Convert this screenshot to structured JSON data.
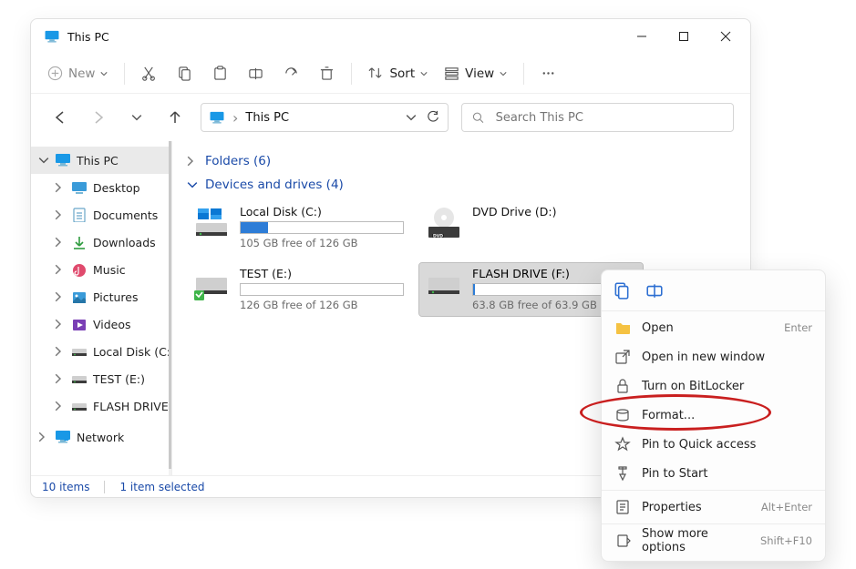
{
  "title": "This PC",
  "toolbar": {
    "new": "New",
    "sort": "Sort",
    "view": "View"
  },
  "address": {
    "segment": "This PC",
    "arrow": "›"
  },
  "search": {
    "placeholder": "Search This PC"
  },
  "nav": {
    "items": [
      {
        "label": "This PC",
        "kind": "thispc",
        "expanded": true,
        "selected": true
      },
      {
        "label": "Desktop",
        "kind": "desktop"
      },
      {
        "label": "Documents",
        "kind": "documents"
      },
      {
        "label": "Downloads",
        "kind": "downloads"
      },
      {
        "label": "Music",
        "kind": "music"
      },
      {
        "label": "Pictures",
        "kind": "pictures"
      },
      {
        "label": "Videos",
        "kind": "videos"
      },
      {
        "label": "Local Disk (C:)",
        "kind": "hdd"
      },
      {
        "label": "TEST (E:)",
        "kind": "usb"
      },
      {
        "label": "FLASH DRIVE (F:)",
        "kind": "usb",
        "clipped": "FLASH DRIVE (F"
      },
      {
        "label": "Network",
        "kind": "network",
        "section": true
      }
    ]
  },
  "groups": {
    "folders": {
      "label": "Folders (6)"
    },
    "drives": {
      "label": "Devices and drives (4)"
    }
  },
  "drives": [
    {
      "name": "Local Disk (C:)",
      "free": "105 GB free of 126 GB",
      "fill_pct": 17,
      "fill_color": "#2e7dd7",
      "icon": "win-hdd"
    },
    {
      "name": "DVD Drive (D:)",
      "icon": "dvd"
    },
    {
      "name": "TEST (E:)",
      "free": "126 GB free of 126 GB",
      "fill_pct": 0,
      "fill_color": "#2e7dd7",
      "icon": "hdd-link"
    },
    {
      "name": "FLASH DRIVE (F:)",
      "free": "63.8 GB free of 63.9 GB",
      "fill_pct": 1,
      "fill_color": "#2e7dd7",
      "icon": "hdd",
      "selected": true
    }
  ],
  "status": {
    "items": "10 items",
    "selected": "1 item selected"
  },
  "ctx": {
    "items": [
      {
        "label": "Open",
        "icon": "folder",
        "shortcut": "Enter"
      },
      {
        "label": "Open in new window",
        "icon": "popout"
      },
      {
        "label": "Turn on BitLocker",
        "icon": "lock"
      },
      {
        "label": "Format...",
        "icon": "format"
      },
      {
        "label": "Pin to Quick access",
        "icon": "star"
      },
      {
        "label": "Pin to Start",
        "icon": "pin"
      },
      {
        "label": "Properties",
        "icon": "properties",
        "shortcut": "Alt+Enter"
      },
      {
        "label": "Show more options",
        "icon": "more",
        "shortcut": "Shift+F10"
      }
    ]
  }
}
